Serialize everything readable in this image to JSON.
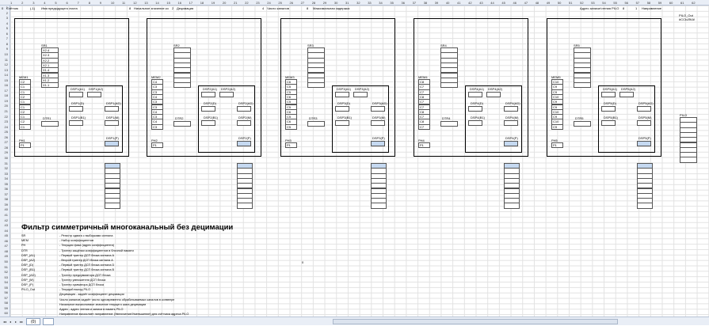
{
  "header_row": {
    "a0": "0",
    "counter_label": "Счётчик",
    "counter_val": "(-1)",
    "prev_sheet_label": "Имя предыдущего листа",
    "a8": "8",
    "initial_label": "Начальное значение ко",
    "initial_val": "2",
    "decim_label": "Децимация",
    "channels_val": "4",
    "channels_label": "Число каналов",
    "delay_val": "8",
    "delay_label": "Максимальная задержка",
    "pilo_addr_label": "Адрес записи/чтения PILO",
    "pilo_addr_val": "8",
    "dir_val": "1",
    "dir_label": "Направление"
  },
  "blocks": [
    {
      "sr": "SR1",
      "mem": "MEM1",
      "dtr": "DTR1",
      "ph": "PH1",
      "p": "P1",
      "dsp": "DSP1",
      "sr_vals": [
        "X2.4",
        "X2.3",
        "X2.2",
        "X2.1",
        "X1.4",
        "X1.3",
        "X1.2",
        "X1.1"
      ],
      "mem_vals": [
        "C2",
        "C1",
        "C1",
        "C2",
        "C1",
        "C1",
        "C2",
        "C1",
        "C2",
        "C1"
      ]
    },
    {
      "sr": "SR2",
      "mem": "MEM2",
      "dtr": "DTR2",
      "ph": "PH2",
      "p": "P1",
      "dsp": "DSP2",
      "sr_vals": [
        "",
        "",
        "",
        "",
        "",
        "",
        "",
        ""
      ],
      "mem_vals": [
        "C4",
        "C3",
        "C3",
        "C4",
        "C3",
        "C3",
        "C4",
        "C3",
        "C4",
        "C3"
      ]
    },
    {
      "sr": "SR3",
      "mem": "MEM3",
      "dtr": "DTR3",
      "ph": "PH3",
      "p": "P1",
      "dsp": "DSP3",
      "sr_vals": [
        "",
        "",
        "",
        "",
        "",
        "",
        "",
        ""
      ],
      "mem_vals": [
        "C6",
        "C5",
        "C5",
        "C6",
        "C5",
        "C5",
        "C6",
        "C5",
        "C6",
        "C5"
      ]
    },
    {
      "sr": "SR4",
      "mem": "MEM4",
      "dtr": "DTR4",
      "ph": "PH4",
      "p": "P1",
      "dsp": "DSP4",
      "sr_vals": [
        "",
        "",
        "",
        "",
        "",
        "",
        "",
        ""
      ],
      "mem_vals": [
        "C8",
        "C7",
        "C7",
        "C8",
        "C7",
        "C7",
        "C8",
        "C7",
        "C8",
        "C7"
      ]
    },
    {
      "sr": "SR5",
      "mem": "MEM5",
      "dtr": "DTR5",
      "ph": "PH5",
      "p": "P1",
      "dsp": "DSP5",
      "sr_vals": [
        "",
        "",
        "",
        "",
        "",
        "",
        "",
        ""
      ],
      "mem_vals": [
        "C10",
        "C9",
        "C9",
        "C10",
        "C9",
        "C9",
        "C10",
        "C9",
        "C10",
        "C9"
      ]
    }
  ],
  "pilo_out_label": "PILO_Out",
  "ref_error": "#ССЫЛКА!",
  "pilo_label": "PILO",
  "stray_zero": "0",
  "title": "Фильтр симметричный многоканальный без децимации",
  "legend": [
    {
      "k": "SR",
      "v": "- Регистр сдвига с выборками сигнала"
    },
    {
      "k": "MEM",
      "v": "- Набор коэффициентов"
    },
    {
      "k": "PH",
      "v": "- Текущая фаза (адрес коэффициента)"
    },
    {
      "k": "DTR",
      "v": "- Триггер защёлки коэффициентов в блочной памяти"
    },
    {
      "k": "DSP_(A1)",
      "v": "- Первый триггер ДСП блока сигнала А"
    },
    {
      "k": "DSP_(A2)",
      "v": "- Второй триггер ДСП блока сигнала А"
    },
    {
      "k": "DSP_(D)",
      "v": "- Первый триггер ДСП блока сигнала D"
    },
    {
      "k": "DSP_(B1)",
      "v": "- Первый триггер ДСП блока сигнала B"
    },
    {
      "k": "DSP_(AD)",
      "v": "- Триггер предсумматора ДСП блока"
    },
    {
      "k": "DSP_(M)",
      "v": "- Триггер умножителя ДСП блока"
    },
    {
      "k": "DSP_(P)",
      "v": "- Триггер сумматора ДСП блока"
    },
    {
      "k": "PILO_Out",
      "v": "- Текущий выход PILO"
    },
    {
      "k": "",
      "v": "Децимация - задаёт коэффициент децимации"
    },
    {
      "k": "",
      "v": "Число каналов задаёт число одновременно обрабатываемых каналов в конвеере"
    },
    {
      "k": "",
      "v": "Начальное вычисляемое значение текущего шага децимации"
    },
    {
      "k": "",
      "v": "Адрес - адрес чтения и записи в память PILO"
    },
    {
      "k": "",
      "v": "Направление вычисляет направление (Увеличение/Уменьшение) для счётчика адреса PILO"
    }
  ],
  "sheet_tab": "(0)",
  "nav": [
    "◂◂",
    "◂",
    "▸",
    "▸▸"
  ]
}
